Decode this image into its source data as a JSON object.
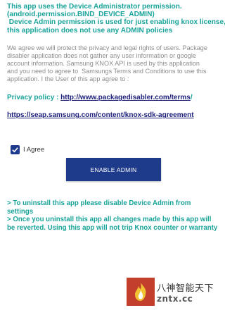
{
  "intro": {
    "lines": [
      "This app uses the Device Administrator permission.",
      "(android.permission.BIND_DEVICE_ADMIN)",
      " Device Admin permission is used for just enabling knox license,",
      "this application does not use any ADMIN policies"
    ]
  },
  "description": {
    "lines": [
      "We agree we will protect the privacy and legal rights of users. Package",
      "disabler application does not gather any user information or google",
      "account information. Samsung KNOX API is used by this application",
      "and you need to agree to  Samsungs Terms and Conditions to use this",
      "application. I the User of this app agree to :"
    ]
  },
  "privacy": {
    "label": "Privacy policy : ",
    "url": "http://www.packagedisabler.com/terms",
    "suffix": "/"
  },
  "terms": {
    "url": "https://seap.samsung.com/content/knox-sdk-agreement"
  },
  "agree": {
    "checked": true,
    "label": "I Agree"
  },
  "enable_button": {
    "label": "ENABLE ADMIN"
  },
  "notes": {
    "lines": [
      "> To uninstall this app please disable Device Admin from",
      "settings",
      "> Once you uninstall this app all changes made by this app will",
      "be reverted. Using this app will not trip Knox counter or warranty"
    ]
  },
  "watermark": {
    "title": "八神智能天下",
    "url": "zntx.cc"
  },
  "colors": {
    "accent": "#1aa39a",
    "link": "#1c1f7a",
    "button": "#1e3a8a",
    "body_text": "#8c8c8c",
    "watermark_logo": "#c2402b"
  }
}
